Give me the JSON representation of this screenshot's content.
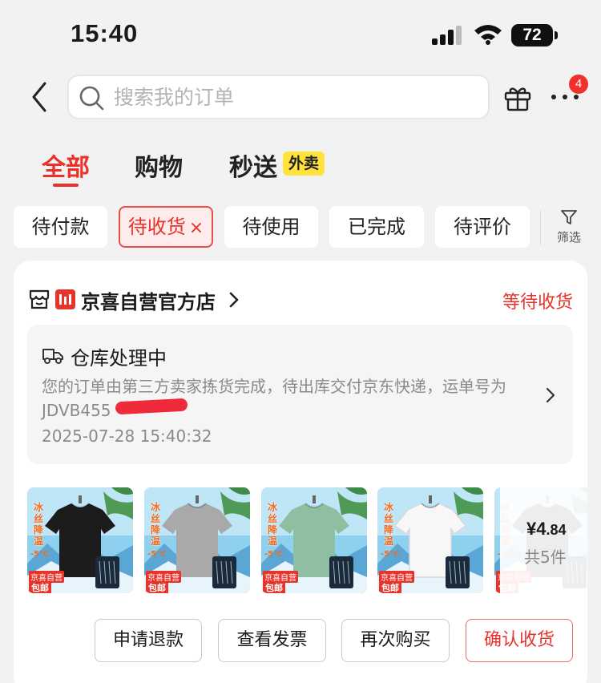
{
  "status_bar": {
    "time": "15:40",
    "battery": "72"
  },
  "header": {
    "search_placeholder": "搜索我的订单",
    "badge_count": "4"
  },
  "tabs": [
    {
      "label": "全部",
      "active": true
    },
    {
      "label": "购物"
    },
    {
      "label": "秒送",
      "tag": "外卖"
    }
  ],
  "filters": {
    "chips": [
      "待付款",
      "待收货",
      "待使用",
      "已完成",
      "待评价"
    ],
    "active": "待收货",
    "close_mark": "×",
    "filter_label": "筛选"
  },
  "order": {
    "shop_name": "京喜自营官方店",
    "status": "等待收货",
    "logistics": {
      "title": "仓库处理中",
      "description": "您的订单由第三方卖家拣货完成，待出库交付京东快递，运单号为JDVB455",
      "time": "2025-07-28 15:40:32"
    },
    "products": [
      {
        "color": "#1c1c1c",
        "promo": "冰丝降温",
        "temp": "-5°C",
        "brand": "京喜自营",
        "tag": "包邮"
      },
      {
        "color": "#a9a9a9",
        "promo": "冰丝降温",
        "temp": "-5°C",
        "brand": "京喜自营",
        "tag": "包邮"
      },
      {
        "color": "#8fbfa3",
        "promo": "冰丝降温",
        "temp": "-5°C",
        "brand": "京喜自营",
        "tag": "包邮"
      },
      {
        "color": "#f7f7f7",
        "promo": "冰丝降温",
        "temp": "-5°C",
        "brand": "京喜自营",
        "tag": "包邮"
      }
    ],
    "price_symbol": "¥",
    "price_int": "4",
    "price_dec": ".84",
    "item_count": "共5件",
    "actions": [
      "申请退款",
      "查看发票",
      "再次购买",
      "确认收货"
    ]
  },
  "colors": {
    "accent": "#e9322b",
    "tag_yellow": "#ffe23c"
  }
}
